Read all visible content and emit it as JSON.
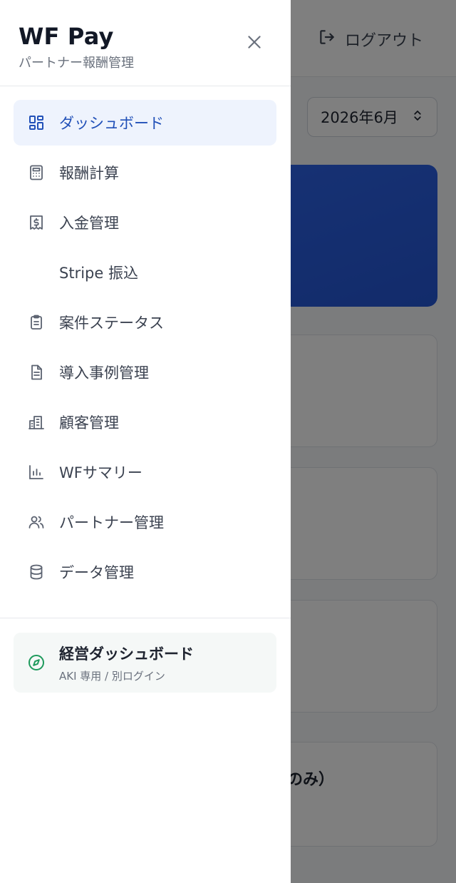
{
  "app": {
    "title": "WF Pay",
    "subtitle": "パートナー報酬管理"
  },
  "header": {
    "logout_label": "ログアウト",
    "month_value": "2026年6月"
  },
  "background": {
    "card4_text": "キのみ）"
  },
  "nav": {
    "items": [
      {
        "label": "ダッシュボード",
        "icon": "dashboard-grid-icon",
        "active": true
      },
      {
        "label": "報酬計算",
        "icon": "calculator-icon"
      },
      {
        "label": "入金管理",
        "icon": "receipt-dollar-icon"
      },
      {
        "label": "Stripe 振込",
        "icon": ""
      },
      {
        "label": "案件ステータス",
        "icon": "clipboard-list-icon"
      },
      {
        "label": "導入事例管理",
        "icon": "document-icon"
      },
      {
        "label": "顧客管理",
        "icon": "building-icon"
      },
      {
        "label": "WFサマリー",
        "icon": "bar-chart-icon"
      },
      {
        "label": "パートナー管理",
        "icon": "users-icon"
      },
      {
        "label": "データ管理",
        "icon": "database-icon"
      }
    ]
  },
  "exec": {
    "title": "経営ダッシュボード",
    "subtitle": "AKI 専用 / 別ログイン",
    "icon": "compass-icon"
  },
  "colors": {
    "accent": "#2150b8",
    "active_bg": "#eef3fd",
    "hero_blue": "#2d63e8",
    "exec_green": "#1e9a5c"
  }
}
